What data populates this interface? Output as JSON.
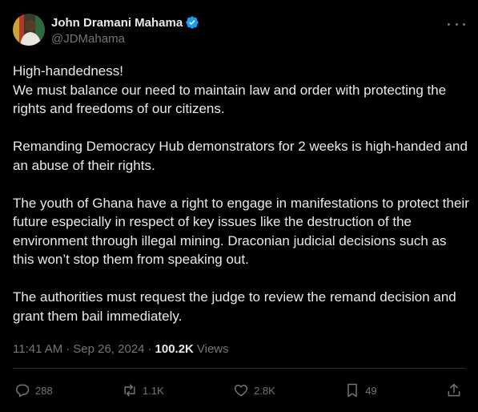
{
  "author": {
    "display_name": "John Dramani Mahama",
    "handle": "@JDMahama"
  },
  "post": {
    "paragraphs": [
      "High-handedness!\nWe must balance our need to maintain law and order with protecting the rights and freedoms of our citizens.",
      "Remanding Democracy Hub demonstrators for 2 weeks is high-handed and an abuse of their rights.",
      "The youth of Ghana have a right to engage in manifestations to protect their future especially in respect of key issues like the destruction of the environment through illegal mining. Draconian judicial decisions such as this won’t stop them from speaking out.",
      "The authorities must request the judge to review the remand decision and grant them bail immediately."
    ]
  },
  "meta": {
    "time": "11:41 AM",
    "date": "Sep 26, 2024",
    "separator": "·",
    "views_count": "100.2K",
    "views_label": "Views"
  },
  "actions": {
    "replies": "288",
    "reposts": "1.1K",
    "likes": "2.8K",
    "bookmarks": "49"
  },
  "colors": {
    "background": "#000000",
    "text": "#e7e9ea",
    "muted": "#71767b",
    "verified": "#1d9bf0",
    "divider": "#2f3336"
  }
}
